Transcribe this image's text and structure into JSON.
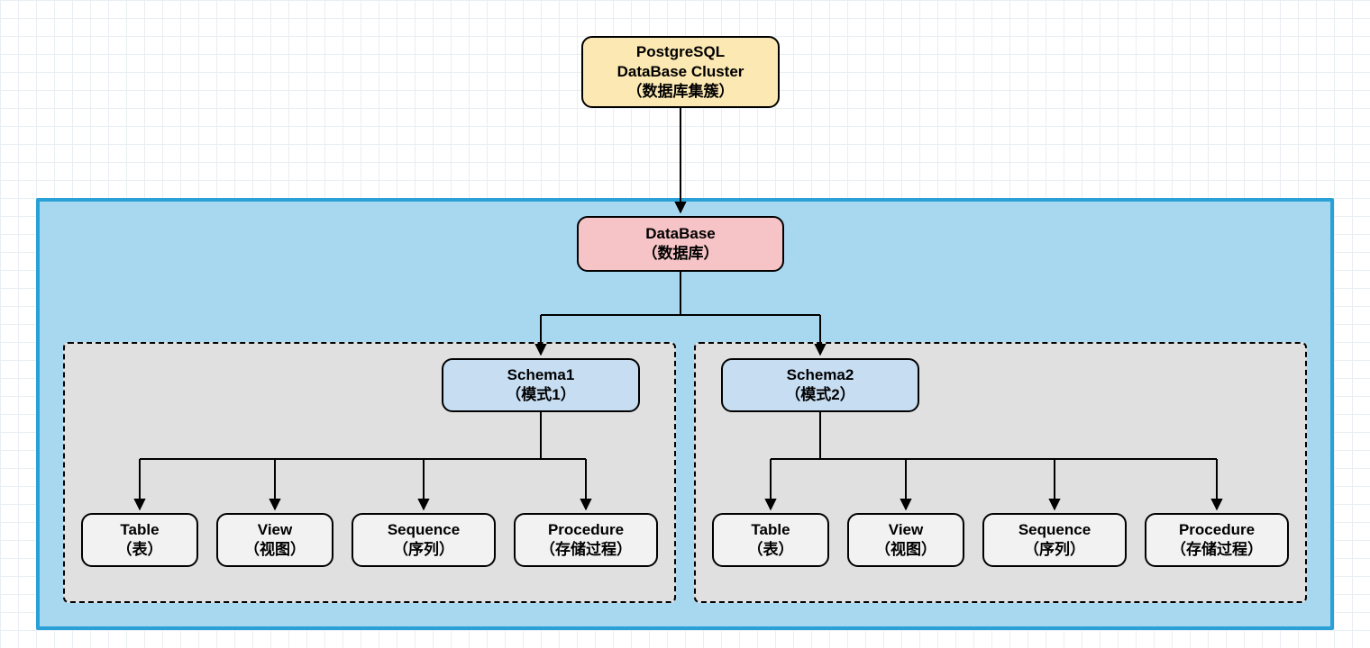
{
  "cluster": {
    "line1": "PostgreSQL",
    "line2": "DataBase Cluster",
    "line3": "（数据库集簇）"
  },
  "database": {
    "line1": "DataBase",
    "line2": "（数据库）"
  },
  "schemas": [
    {
      "line1": "Schema1",
      "line2": "（模式1）"
    },
    {
      "line1": "Schema2",
      "line2": "（模式2）"
    }
  ],
  "objects": {
    "table": {
      "line1": "Table",
      "line2": "（表）"
    },
    "view": {
      "line1": "View",
      "line2": "（视图）"
    },
    "sequence": {
      "line1": "Sequence",
      "line2": "（序列）"
    },
    "procedure": {
      "line1": "Procedure",
      "line2": "（存储过程）"
    }
  },
  "colors": {
    "cluster_bg": "#fce8b2",
    "database_bg": "#f6c3c6",
    "schema_bg": "#c7ddf2",
    "leaf_bg": "#f2f2f2",
    "container_border": "#2aa1d6",
    "container_bg": "#a8d8ef",
    "dash_bg": "#e0e0e0"
  }
}
